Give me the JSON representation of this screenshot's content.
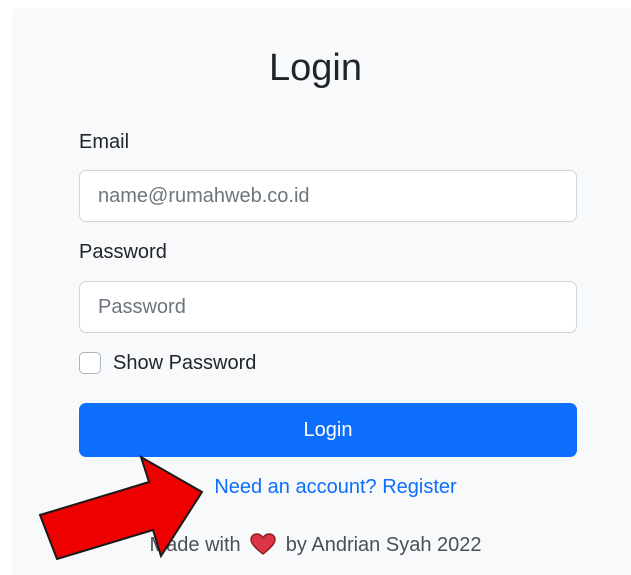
{
  "title": "Login",
  "email": {
    "label": "Email",
    "placeholder": "name@rumahweb.co.id"
  },
  "password": {
    "label": "Password",
    "placeholder": "Password"
  },
  "show_password": {
    "label": "Show Password",
    "checked": false
  },
  "login_button": {
    "label": "Login"
  },
  "register_link": {
    "label": "Need an account? Register"
  },
  "footer": {
    "before": "Made with",
    "after": "by Andrian Syah 2022"
  },
  "colors": {
    "primary": "#0d6efd",
    "card_background": "#f8f9fa",
    "heart": "#dc3545",
    "arrow": "#ee0000"
  },
  "icons": {
    "heart": "heart-icon",
    "annotation": "red-arrow-icon"
  }
}
